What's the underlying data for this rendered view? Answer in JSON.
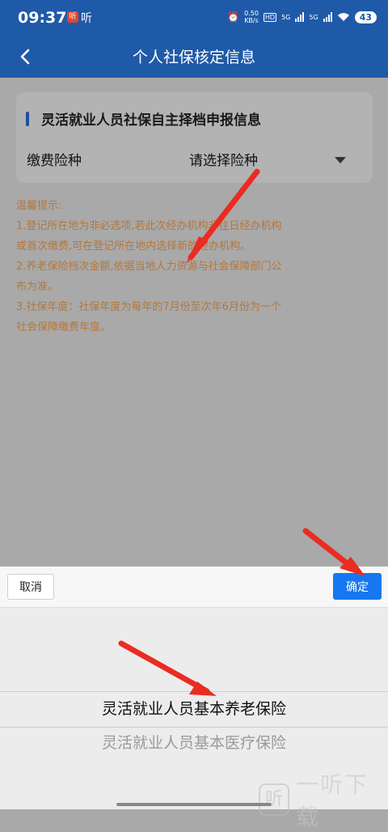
{
  "status_bar": {
    "time": "09:37",
    "app_badge": "听",
    "app_badge2": "听",
    "net_speed_value": "0.50",
    "net_speed_unit": "KB/s",
    "hd_label": "HD",
    "signal1_label": "5G",
    "signal2_label": "5G",
    "battery": "43"
  },
  "header": {
    "title": "个人社保核定信息"
  },
  "card": {
    "title": "灵活就业人员社保自主择档申报信息",
    "field_label": "缴费险种",
    "field_value": "请选择险种"
  },
  "tips": [
    "温馨提示:",
    "1.登记所在地为非必选项,若此次经办机构非往日经办机构",
    "或首次缴费,可在登记所在地内选择新的经办机构。",
    "2.养老保险档次金额,依据当地人力资源与社会保障部门公",
    "布为准。",
    "3.社保年度：社保年度为每年的7月份至次年6月份为一个",
    "社会保障缴费年度。"
  ],
  "picker": {
    "cancel_label": "取消",
    "confirm_label": "确定",
    "selected_option": "灵活就业人员基本养老保险",
    "next_option": "灵活就业人员基本医疗保险"
  },
  "watermark": {
    "mark": "听",
    "text": "一听下载"
  },
  "colors": {
    "header": "#1f5aa8",
    "tips_text": "#b4773b",
    "confirm": "#1677f0",
    "arrow": "#ea2c22"
  }
}
